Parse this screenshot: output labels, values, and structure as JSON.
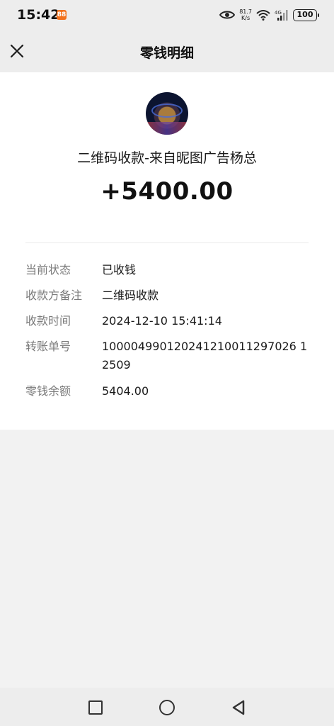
{
  "status_bar": {
    "time": "15:42",
    "app_badge": "88",
    "speed_value": "81.7",
    "speed_unit": "K/s",
    "network": "4G",
    "battery": "100"
  },
  "header": {
    "title": "零钱明细"
  },
  "transaction": {
    "payer": "二维码收款-来自昵图广告杨总",
    "amount": "+5400.00",
    "details": [
      {
        "label": "当前状态",
        "value": "已收钱"
      },
      {
        "label": "收款方备注",
        "value": "二维码收款"
      },
      {
        "label": "收款时间",
        "value": "2024-12-10 15:41:14"
      },
      {
        "label": "转账单号",
        "value": "100004990120241210011297026 12509"
      },
      {
        "label": "零钱余额",
        "value": "5404.00"
      }
    ]
  },
  "colors": {
    "background": "#f2f2f2",
    "card": "#ffffff",
    "label": "#7a7a7a"
  }
}
